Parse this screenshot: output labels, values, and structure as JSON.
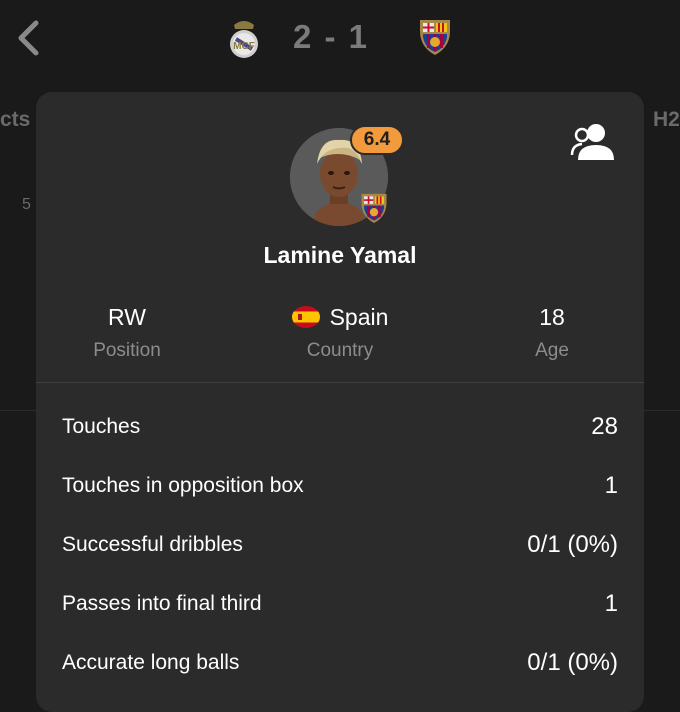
{
  "header": {
    "score": "2 - 1",
    "home_team_crest": "real-madrid-crest",
    "away_team_crest": "barcelona-crest",
    "background_tab_left": "cts",
    "background_tab_right": "H2",
    "background_number": "5"
  },
  "player": {
    "name": "Lamine Yamal",
    "rating": "6.4",
    "rating_color": "#f39a3c",
    "position_value": "RW",
    "position_label": "Position",
    "country_value": "Spain",
    "country_label": "Country",
    "age_value": "18",
    "age_label": "Age"
  },
  "stats": [
    {
      "label": "Touches",
      "value": "28"
    },
    {
      "label": "Touches in opposition box",
      "value": "1"
    },
    {
      "label": "Successful dribbles",
      "value": "0/1 (0%)"
    },
    {
      "label": "Passes into final third",
      "value": "1"
    },
    {
      "label": "Accurate long balls",
      "value": "0/1 (0%)"
    }
  ]
}
